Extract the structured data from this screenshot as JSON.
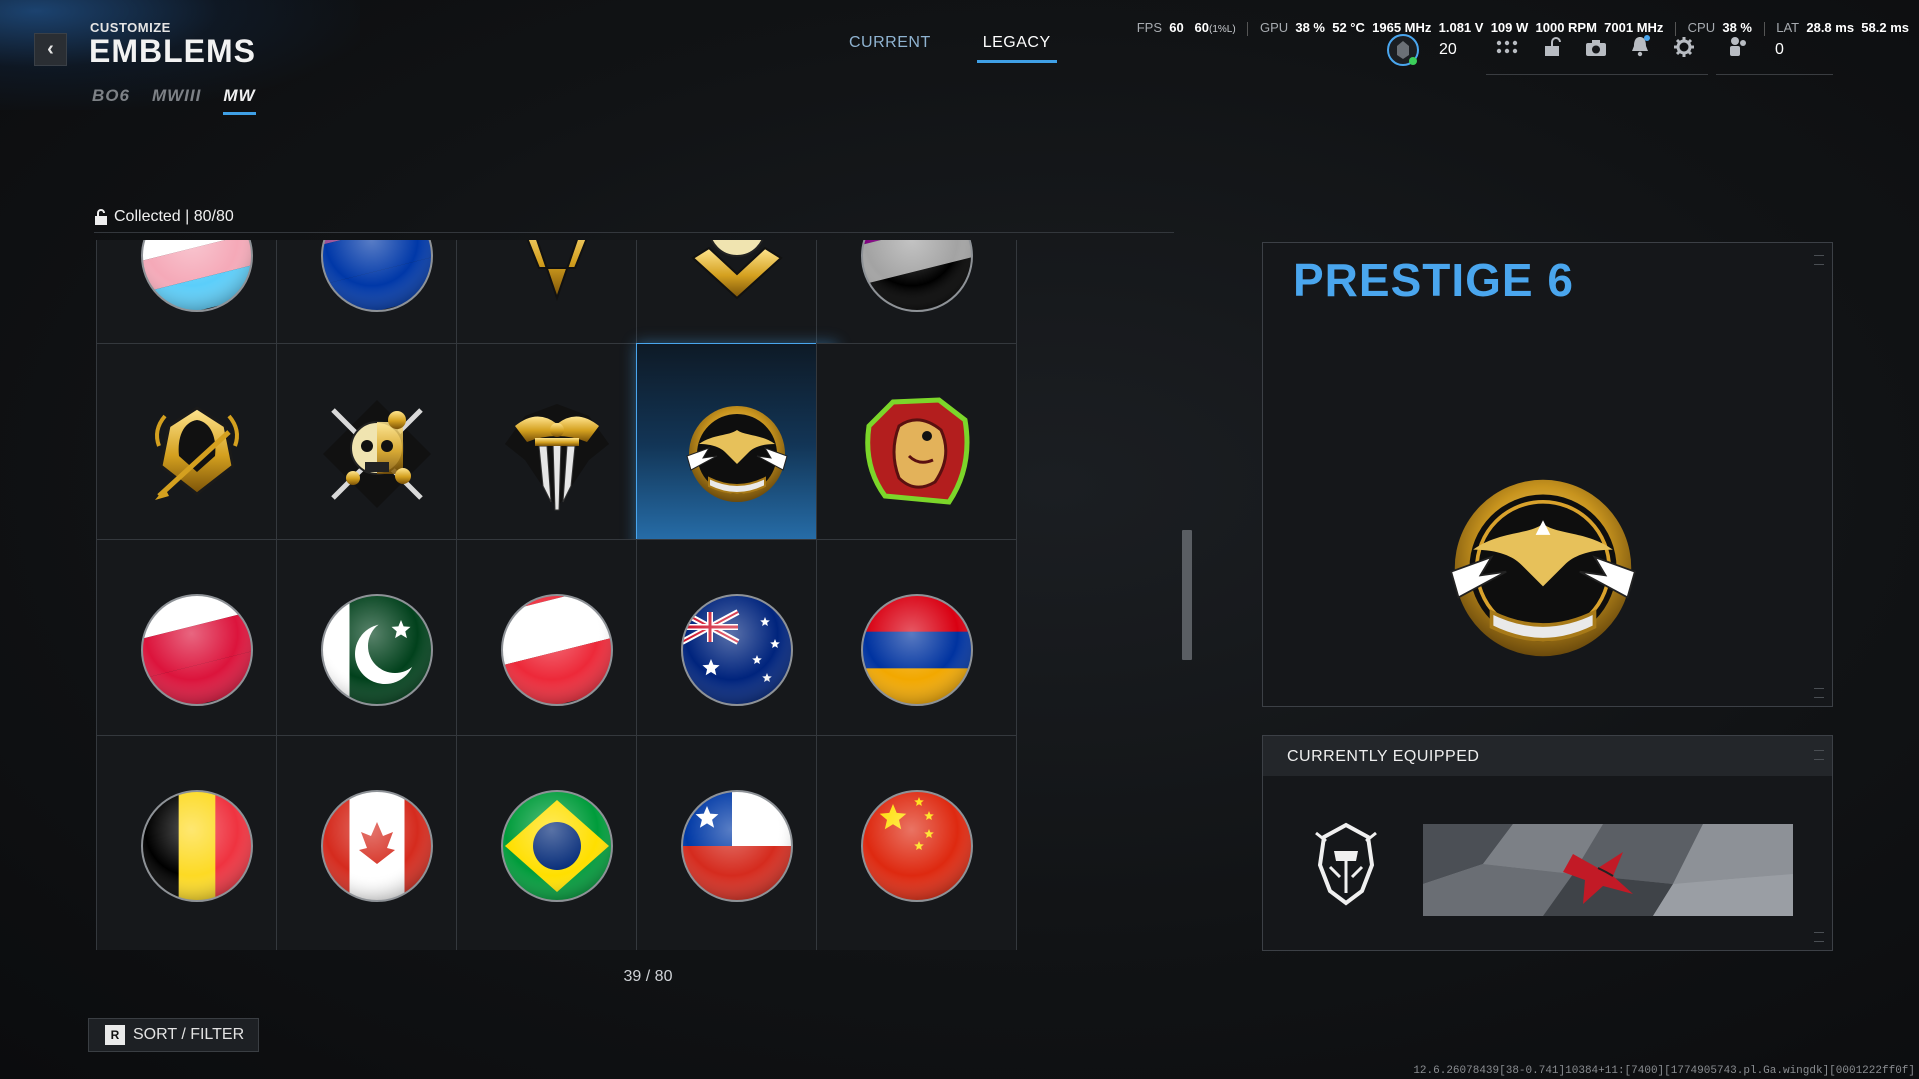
{
  "header": {
    "subtitle": "CUSTOMIZE",
    "title": "EMBLEMS",
    "back_icon": "chevron-left-icon",
    "game_tabs": [
      {
        "label": "BO6",
        "active": false
      },
      {
        "label": "MWIII",
        "active": false
      },
      {
        "label": "MW",
        "active": true
      }
    ],
    "mode_tabs": [
      {
        "label": "CURRENT",
        "active": false
      },
      {
        "label": "LEGACY",
        "active": true
      }
    ]
  },
  "overlay_stats": {
    "fps_label": "FPS",
    "fps_value": "60",
    "fps_low": "60",
    "fps_low_label": "(1%L)",
    "gpu_label": "GPU",
    "gpu_util": "38 %",
    "gpu_temp": "52 °C",
    "gpu_clock": "1965 MHz",
    "gpu_voltage": "1.081 V",
    "gpu_power": "109 W",
    "gpu_fan": "1000 RPM",
    "gpu_mem_clock": "7001 MHz",
    "cpu_label": "CPU",
    "cpu_util": "38 %",
    "lat_label": "LAT",
    "lat_1": "28.8 ms",
    "lat_2": "58.2 ms"
  },
  "hud": {
    "rank_level": "20",
    "party_count": "0",
    "icons": [
      "rank-badge-icon",
      "grid-menu-icon",
      "lock-icon",
      "camera-icon",
      "bell-icon",
      "gear-icon",
      "party-icon"
    ]
  },
  "collection": {
    "label": "Collected | 80/80",
    "lock_icon": "unlocked-icon"
  },
  "grid": {
    "rows": [
      [
        "flag-trans-pride",
        "flag-bi-pride",
        "gold-winged-emblem",
        "gold-skull-emblem",
        "flag-asexual-pride"
      ],
      [
        "gold-reaper-emblem",
        "gold-skull-roses-emblem",
        "gold-daggers-emblem",
        "prestige-6-eagle-emblem",
        "red-dragon-emblem"
      ],
      [
        "flag-poland",
        "flag-pakistan",
        "flag-austria",
        "flag-australia",
        "flag-armenia"
      ],
      [
        "flag-belgium",
        "flag-canada",
        "flag-brazil",
        "flag-chile",
        "flag-china"
      ]
    ],
    "selected_row": 1,
    "selected_col": 3,
    "page_counter": "39 / 80"
  },
  "sort_filter": {
    "key": "R",
    "label": "SORT / FILTER"
  },
  "preview": {
    "title": "PRESTIGE 6",
    "emblem": "prestige-6-eagle-emblem"
  },
  "equipped": {
    "header": "CURRENTLY EQUIPPED",
    "emblem": "white-helmet-emblem",
    "calling_card": "shattered-glass-calling-card"
  },
  "footer_code": "12.6.26078439[38-0.741]10384+11:[7400][1774905743.pl.Ga.wingdk][0001222ff0f]",
  "colors": {
    "accent": "#4aa6ee",
    "background": "#111315",
    "tile_bg": "#16181b"
  }
}
